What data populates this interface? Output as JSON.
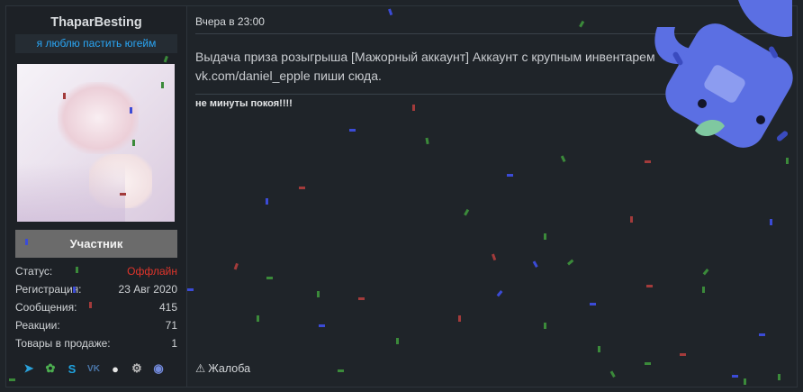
{
  "user": {
    "name": "ThaparBesting",
    "title": "я люблю пастить югейм",
    "role": "Участник"
  },
  "stats": [
    {
      "label": "Статус:",
      "value": "Оффлайн",
      "status": "offline"
    },
    {
      "label": "Регистрация:",
      "value": "23 Авг 2020"
    },
    {
      "label": "Сообщения:",
      "value": "415"
    },
    {
      "label": "Реакции:",
      "value": "71"
    },
    {
      "label": "Товары в продаже:",
      "value": "1"
    }
  ],
  "socials": [
    {
      "icon": "telegram-icon",
      "glyph": "➤",
      "color": "#2aa1da"
    },
    {
      "icon": "icq-icon",
      "glyph": "✿",
      "color": "#4caf50"
    },
    {
      "icon": "skype-icon",
      "glyph": "S",
      "color": "#1fa3e0"
    },
    {
      "icon": "vk-icon",
      "glyph": "VK",
      "color": "#4a76a8"
    },
    {
      "icon": "github-icon",
      "glyph": "●",
      "color": "#e6e6e6"
    },
    {
      "icon": "steam-icon",
      "glyph": "⚙",
      "color": "#bdbdbd"
    },
    {
      "icon": "discord-icon",
      "glyph": "◉",
      "color": "#7289da"
    }
  ],
  "post": {
    "date": "Вчера в 23:00",
    "line1": "Выдача приза розыгрыша [Мажорный аккаунт] Аккаунт с крупным инвентарем",
    "line2": "vk.com/daniel_epple пиши сюда.",
    "signature": "не минуты покоя!!!!",
    "report_label": "Жалоба",
    "report_glyph": "⚠"
  },
  "colors": {
    "accent": "#2aa6f5",
    "offline": "#e0352b",
    "mascot": "#5b6fe3"
  }
}
